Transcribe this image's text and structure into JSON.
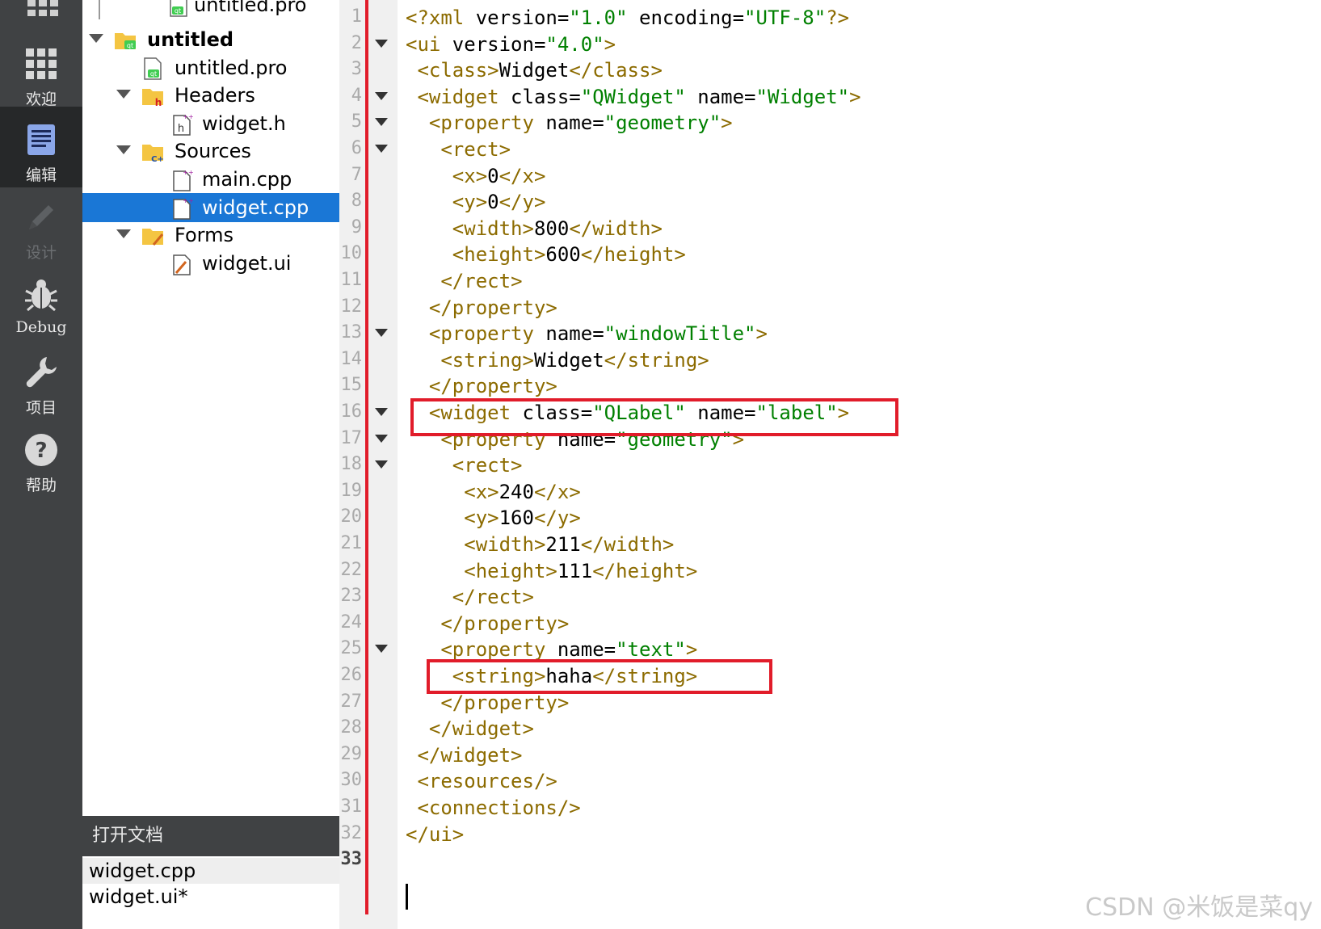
{
  "modebar": {
    "items": [
      {
        "label": "欢迎",
        "icon": "grid-icon"
      },
      {
        "label": "编辑",
        "icon": "edit-document-icon"
      },
      {
        "label": "设计",
        "icon": "pencil-icon"
      },
      {
        "label": "Debug",
        "icon": "bug-icon"
      },
      {
        "label": "项目",
        "icon": "wrench-icon"
      },
      {
        "label": "帮助",
        "icon": "help-icon"
      }
    ],
    "active": "编辑"
  },
  "tree": {
    "rows": [
      {
        "label": "untitled.pro",
        "icon": "qt-project-file-icon"
      },
      {
        "label": "untitled",
        "icon": "qt-project-folder-icon"
      },
      {
        "label": "untitled.pro",
        "icon": "qt-project-file-icon"
      },
      {
        "label": "Headers",
        "icon": "headers-folder-icon"
      },
      {
        "label": "widget.h",
        "icon": "header-file-icon"
      },
      {
        "label": "Sources",
        "icon": "sources-folder-icon"
      },
      {
        "label": "main.cpp",
        "icon": "cpp-file-icon"
      },
      {
        "label": "widget.cpp",
        "icon": "cpp-file-icon"
      },
      {
        "label": "Forms",
        "icon": "forms-folder-icon"
      },
      {
        "label": "widget.ui",
        "icon": "ui-file-icon"
      }
    ],
    "selected": "widget.cpp"
  },
  "open_documents": {
    "title": "打开文档",
    "items": [
      "widget.cpp",
      "widget.ui*"
    ]
  },
  "editor": {
    "line_numbers": [
      "1",
      "2",
      "3",
      "4",
      "5",
      "6",
      "7",
      "8",
      "9",
      "10",
      "11",
      "12",
      "13",
      "14",
      "15",
      "16",
      "17",
      "18",
      "19",
      "20",
      "21",
      "22",
      "23",
      "24",
      "25",
      "26",
      "27",
      "28",
      "29",
      "30",
      "31",
      "32",
      "33"
    ],
    "current_line": "33",
    "lines": [
      "<?xml version=\"1.0\" encoding=\"UTF-8\"?>",
      "<ui version=\"4.0\">",
      " <class>Widget</class>",
      " <widget class=\"QWidget\" name=\"Widget\">",
      "  <property name=\"geometry\">",
      "   <rect>",
      "    <x>0</x>",
      "    <y>0</y>",
      "    <width>800</width>",
      "    <height>600</height>",
      "   </rect>",
      "  </property>",
      "  <property name=\"windowTitle\">",
      "   <string>Widget</string>",
      "  </property>",
      "  <widget class=\"QLabel\" name=\"label\">",
      "   <property name=\"geometry\">",
      "    <rect>",
      "     <x>240</x>",
      "     <y>160</y>",
      "     <width>211</width>",
      "     <height>111</height>",
      "    </rect>",
      "   </property>",
      "   <property name=\"text\">",
      "    <string>haha</string>",
      "   </property>",
      "  </widget>",
      " </widget>",
      " <resources/>",
      " <connections/>",
      "</ui>",
      ""
    ],
    "fold_lines": [
      "2",
      "4",
      "5",
      "6",
      "13",
      "16",
      "17",
      "18",
      "25"
    ],
    "highlight_color": "#e11c2a"
  },
  "watermark": "CSDN @米饭是菜qy"
}
